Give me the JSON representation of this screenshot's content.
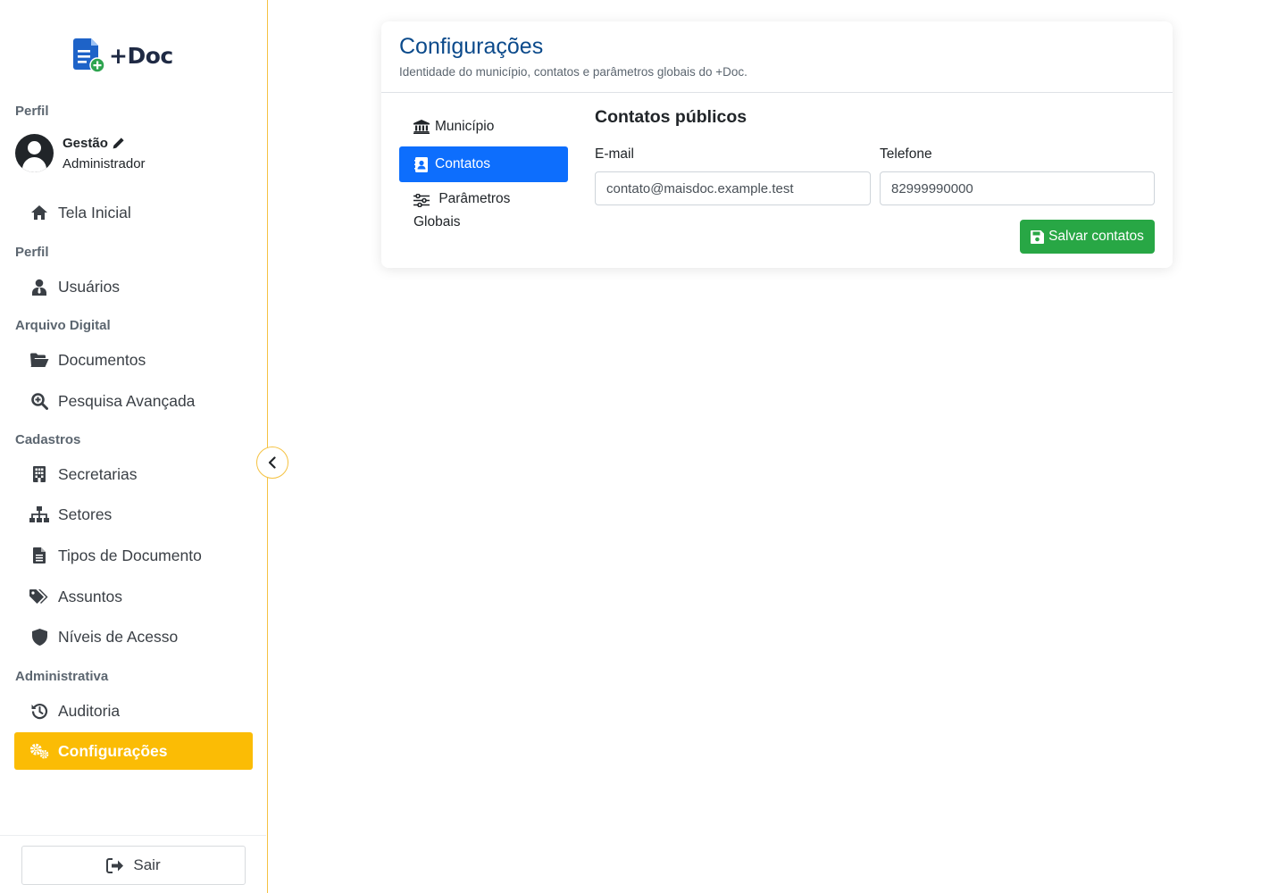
{
  "app": {
    "logo_text": "+Doc"
  },
  "sidebar": {
    "profile_label": "Perfil",
    "profile": {
      "name": "Gestão",
      "role": "Administrador"
    },
    "home": {
      "label": "Tela Inicial",
      "icon": "home-icon"
    },
    "sections": [
      {
        "label": "Perfil",
        "items": [
          {
            "label": "Usuários",
            "icon": "user-tie-icon"
          }
        ]
      },
      {
        "label": "Arquivo Digital",
        "items": [
          {
            "label": "Documentos",
            "icon": "folder-open-icon"
          },
          {
            "label": "Pesquisa Avançada",
            "icon": "search-plus-icon"
          }
        ]
      },
      {
        "label": "Cadastros",
        "items": [
          {
            "label": "Secretarias",
            "icon": "building-icon"
          },
          {
            "label": "Setores",
            "icon": "sitemap-icon"
          },
          {
            "label": "Tipos de Documento",
            "icon": "file-alt-icon"
          },
          {
            "label": "Assuntos",
            "icon": "tags-icon"
          },
          {
            "label": "Níveis de Acesso",
            "icon": "shield-icon"
          }
        ]
      },
      {
        "label": "Administrativa",
        "items": [
          {
            "label": "Auditoria",
            "icon": "history-icon"
          },
          {
            "label": "Configurações",
            "icon": "cogs-icon",
            "active": true
          }
        ]
      }
    ],
    "logout_label": "Sair",
    "accent_color": "#fbbc05"
  },
  "page": {
    "title": "Configurações",
    "subtitle": "Identidade do município, contatos e parâmetros globais do +Doc.",
    "tabs": [
      {
        "label": "Município",
        "icon": "landmark-icon"
      },
      {
        "label": "Contatos",
        "icon": "address-book-icon",
        "active": true
      },
      {
        "label": "Parâmetros Globais",
        "icon": "sliders-icon"
      }
    ],
    "form": {
      "title": "Contatos públicos",
      "email_label": "E-mail",
      "email_value": "contato@maisdoc.example.test",
      "phone_label": "Telefone",
      "phone_value": "82999990000",
      "save_label": "Salvar contatos"
    },
    "colors": {
      "title": "#0b4a8b",
      "primary": "#0d6efd",
      "success": "#28a745"
    }
  }
}
